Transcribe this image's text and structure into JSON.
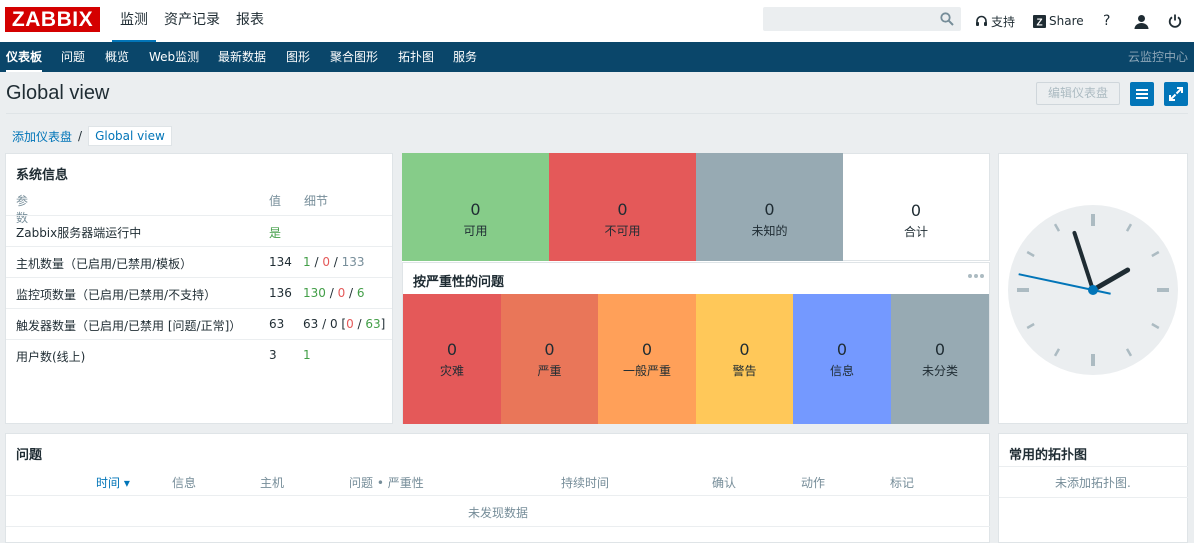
{
  "header": {
    "logo": "ZABBIX",
    "nav": [
      "监测",
      "资产记录",
      "报表"
    ],
    "support": "支持",
    "share": "Share",
    "help": "?"
  },
  "subnav": {
    "items": [
      "仪表板",
      "问题",
      "概览",
      "Web监测",
      "最新数据",
      "图形",
      "聚合图形",
      "拓扑图",
      "服务"
    ],
    "right": "云监控中心"
  },
  "page": {
    "title": "Global view",
    "edit_button": "编辑仪表盘",
    "breadcrumb_1": "添加仪表盘",
    "breadcrumb_sep": "/",
    "breadcrumb_2": "Global view"
  },
  "system_info": {
    "title": "系统信息",
    "columns": [
      "参数",
      "值",
      "细节"
    ],
    "rows": [
      {
        "param": "Zabbix服务器端运行中",
        "value": "是",
        "detail": [
          "",
          "",
          "",
          "",
          ""
        ]
      },
      {
        "param": "主机数量（已启用/已禁用/模板）",
        "value": "134",
        "detail": [
          "1",
          " / ",
          "0",
          " / ",
          "133"
        ]
      },
      {
        "param": "监控项数量（已启用/已禁用/不支持）",
        "value": "136",
        "detail": [
          "130",
          " / ",
          "0",
          " / ",
          "6"
        ]
      },
      {
        "param": "触发器数量（已启用/已禁用 [问题/正常]）",
        "value": "63",
        "detail": [
          "63 / 0 [",
          "0",
          " / ",
          "63",
          "]"
        ]
      },
      {
        "param": "用户数(线上)",
        "value": "3",
        "detail": [
          "1",
          "",
          "",
          "",
          ""
        ]
      }
    ]
  },
  "host_availability": {
    "tiles": [
      {
        "num": "0",
        "label": "可用",
        "color": "#86cc89"
      },
      {
        "num": "0",
        "label": "不可用",
        "color": "#e45959"
      },
      {
        "num": "0",
        "label": "未知的",
        "color": "#97aab3"
      },
      {
        "num": "0",
        "label": "合计",
        "color": "#ffffff"
      }
    ]
  },
  "problems_by_severity": {
    "title": "按严重性的问题",
    "tiles": [
      {
        "num": "0",
        "label": "灾难",
        "color": "#e45959"
      },
      {
        "num": "0",
        "label": "严重",
        "color": "#e97659"
      },
      {
        "num": "0",
        "label": "一般严重",
        "color": "#ffa059"
      },
      {
        "num": "0",
        "label": "警告",
        "color": "#ffc859"
      },
      {
        "num": "0",
        "label": "信息",
        "color": "#7499ff"
      },
      {
        "num": "0",
        "label": "未分类",
        "color": "#97aab3"
      }
    ]
  },
  "clock": {
    "hour_angle": 60,
    "minute_angle": -18,
    "second_angle": -78
  },
  "problems": {
    "title": "问题",
    "columns": [
      "时间 ▾",
      "信息",
      "主机",
      "问题 • 严重性",
      "持续时间",
      "确认",
      "动作",
      "标记"
    ],
    "empty": "未发现数据"
  },
  "favourite_maps": {
    "title": "常用的拓扑图",
    "empty": "未添加拓扑图."
  }
}
